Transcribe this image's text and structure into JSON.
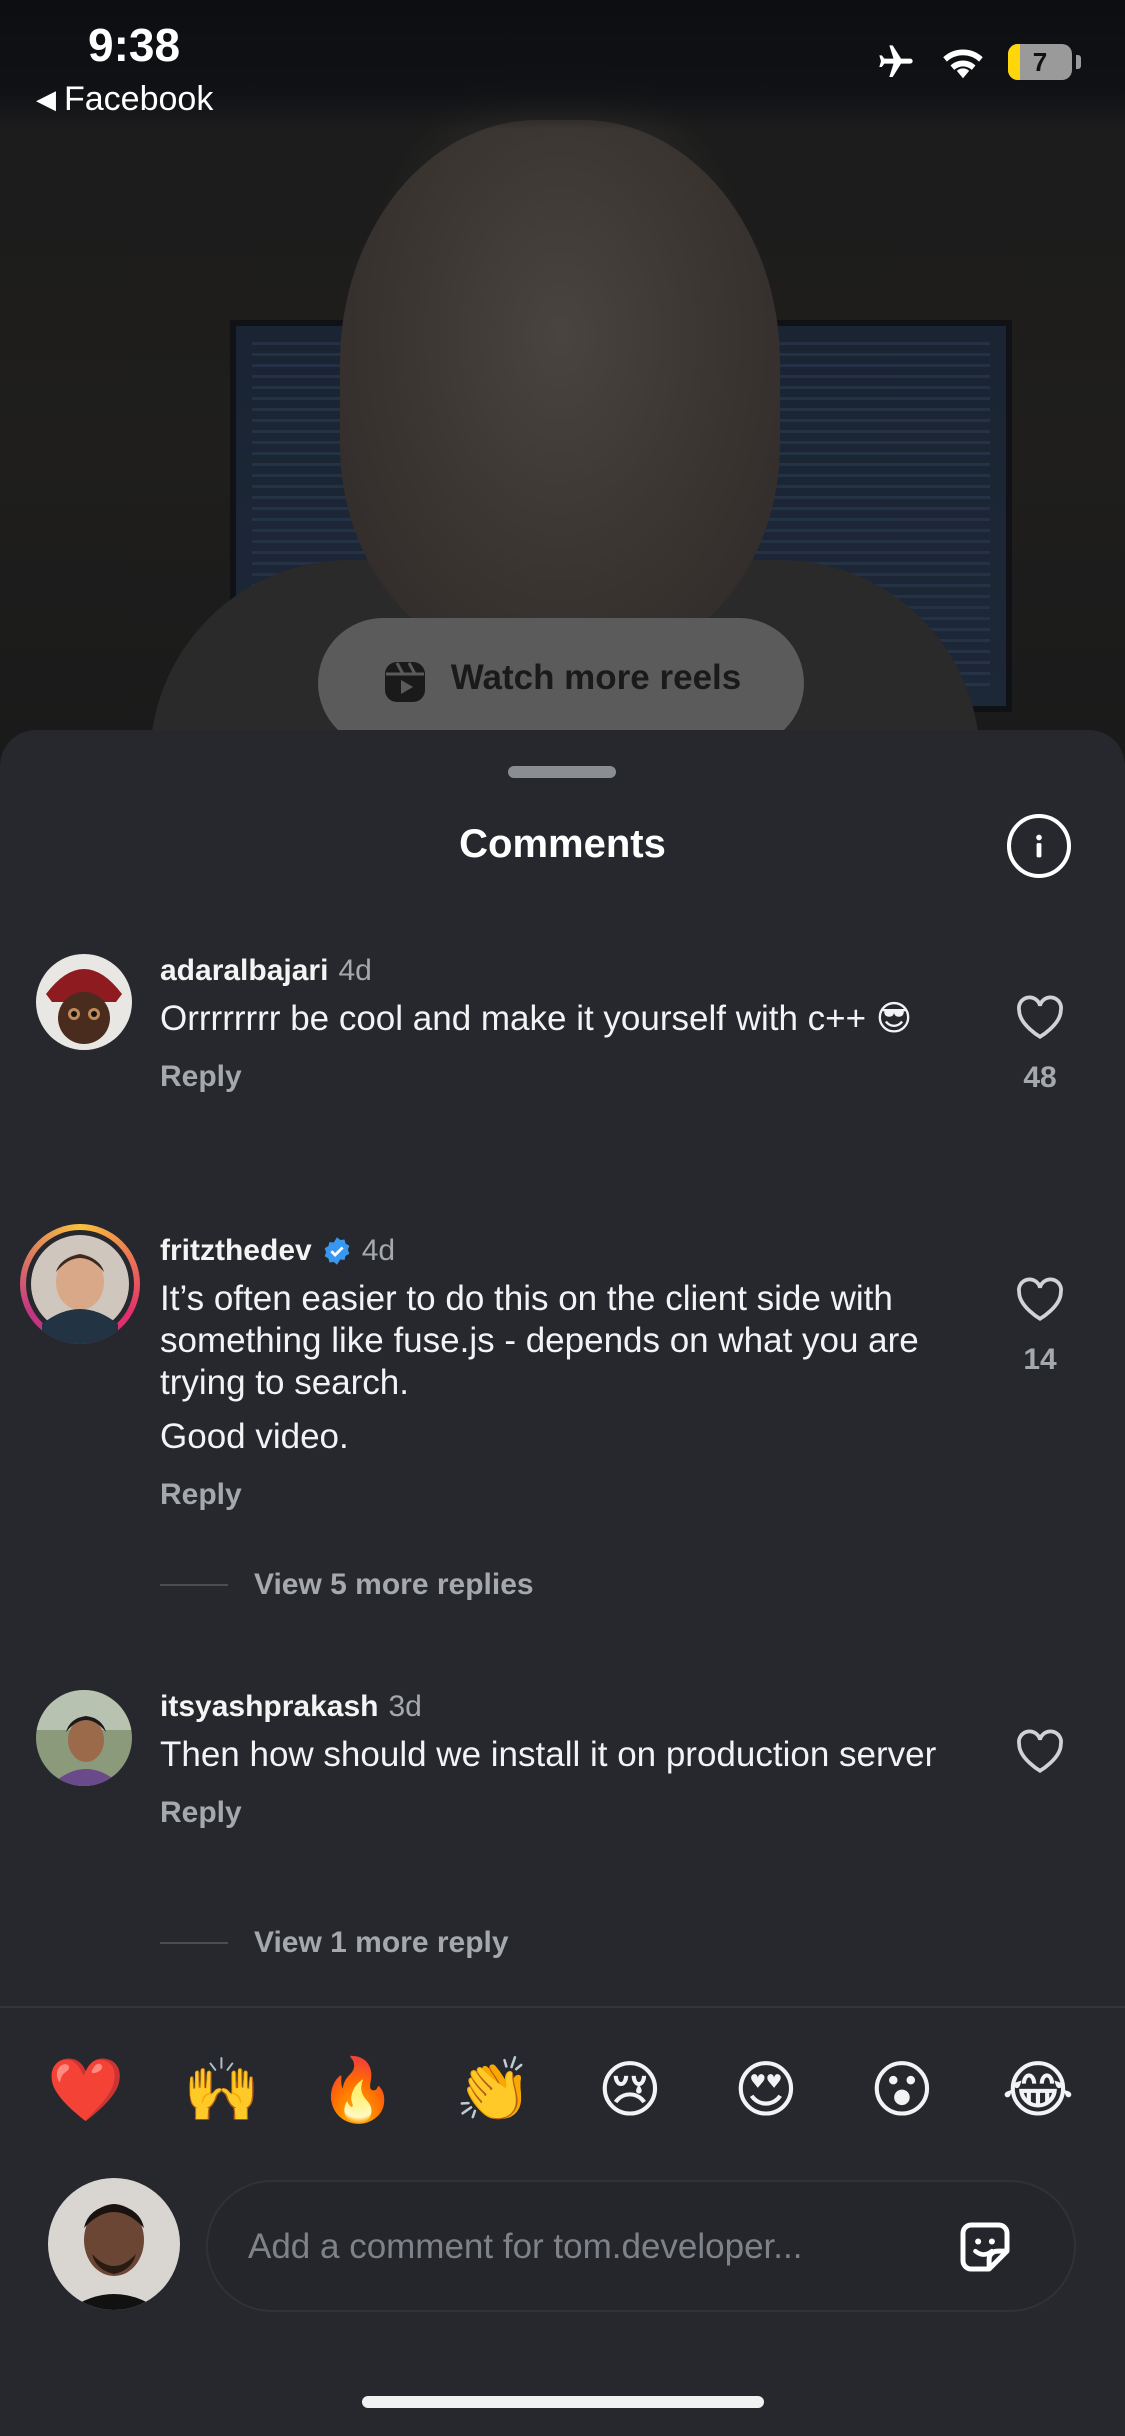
{
  "status_bar": {
    "time": "9:38",
    "back_app": "Facebook",
    "battery_level": "7",
    "icons": [
      "airplane-icon",
      "wifi-icon",
      "battery-icon"
    ]
  },
  "video": {
    "watch_more_label": "Watch more reels"
  },
  "sheet": {
    "title": "Comments",
    "comments": [
      {
        "username": "adaralbajari",
        "age": "4d",
        "verified": false,
        "text": "Orrrrrrrr be cool and make it yourself with c++ 😎",
        "reply_label": "Reply",
        "likes": "48"
      },
      {
        "username": "fritzthedev",
        "age": "4d",
        "verified": true,
        "text": "It’s often easier to do this on the client side with something like fuse.js - depends on what you are trying to search.",
        "text2": "Good video.",
        "reply_label": "Reply",
        "likes": "14",
        "more_replies": "View 5 more replies"
      },
      {
        "username": "itsyashprakash",
        "age": "3d",
        "verified": false,
        "text": "Then how should we install it on production server",
        "reply_label": "Reply",
        "likes": "",
        "more_replies": "View 1 more reply"
      }
    ],
    "quick_emojis": [
      "❤️",
      "🙌",
      "🔥",
      "👏",
      "😢",
      "😍",
      "😮",
      "😂"
    ],
    "input_placeholder": "Add a comment for tom.developer..."
  },
  "colors": {
    "sheet_bg": "#26282d",
    "verified_blue": "#3897f0",
    "muted_text": "#a5a8ad"
  }
}
